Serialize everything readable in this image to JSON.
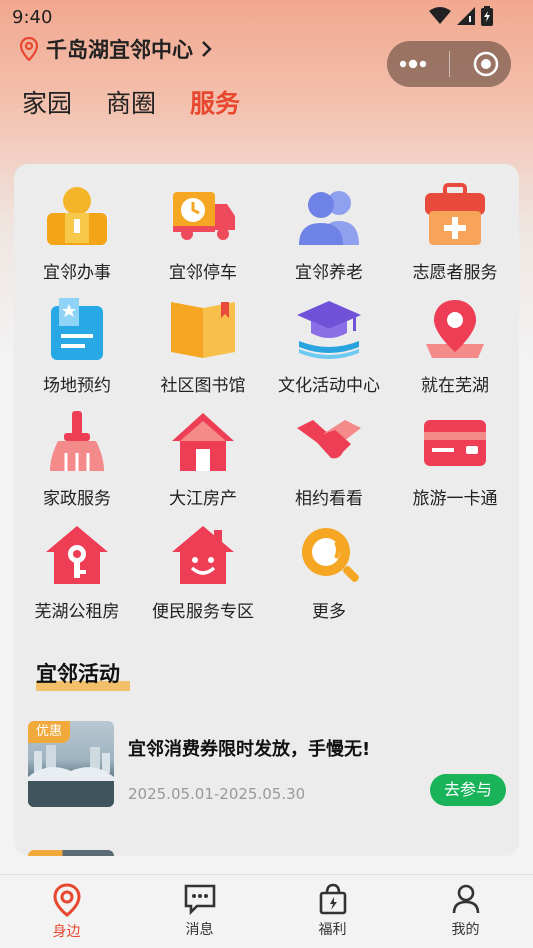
{
  "status": {
    "time": "9:40"
  },
  "location": {
    "name": "千岛湖宜邻中心"
  },
  "tabs": [
    {
      "label": "家园",
      "active": false
    },
    {
      "label": "商圈",
      "active": false
    },
    {
      "label": "服务",
      "active": true
    }
  ],
  "services": [
    {
      "label": "宜邻办事",
      "icon": "office-person-icon"
    },
    {
      "label": "宜邻停车",
      "icon": "parking-truck-icon"
    },
    {
      "label": "宜邻养老",
      "icon": "elderly-people-icon"
    },
    {
      "label": "志愿者服务",
      "icon": "volunteer-medkit-icon"
    },
    {
      "label": "场地预约",
      "icon": "venue-booking-icon"
    },
    {
      "label": "社区图书馆",
      "icon": "library-book-icon"
    },
    {
      "label": "文化活动中心",
      "icon": "culture-cap-icon"
    },
    {
      "label": "就在芜湖",
      "icon": "location-pin-icon"
    },
    {
      "label": "家政服务",
      "icon": "broom-icon"
    },
    {
      "label": "大江房产",
      "icon": "house-icon"
    },
    {
      "label": "相约看看",
      "icon": "handshake-icon"
    },
    {
      "label": "旅游一卡通",
      "icon": "travel-card-icon"
    },
    {
      "label": "芜湖公租房",
      "icon": "house-key-icon"
    },
    {
      "label": "便民服务专区",
      "icon": "smile-house-icon"
    },
    {
      "label": "更多",
      "icon": "more-search-icon"
    }
  ],
  "activities_section": {
    "title": "宜邻活动"
  },
  "activity": {
    "badge": "优惠",
    "title": "宜邻消费券限时发放，手慢无!",
    "date": "2025.05.01-2025.05.30",
    "action": "去参与"
  },
  "bottom_nav": [
    {
      "label": "身边",
      "icon": "nearby-pin-icon",
      "active": true
    },
    {
      "label": "消息",
      "icon": "message-icon",
      "active": false
    },
    {
      "label": "福利",
      "icon": "gift-bag-icon",
      "active": false
    },
    {
      "label": "我的",
      "icon": "profile-icon",
      "active": false
    }
  ],
  "colors": {
    "accent": "#e8472f",
    "green": "#19b35a",
    "highlight": "#f3c06a"
  }
}
